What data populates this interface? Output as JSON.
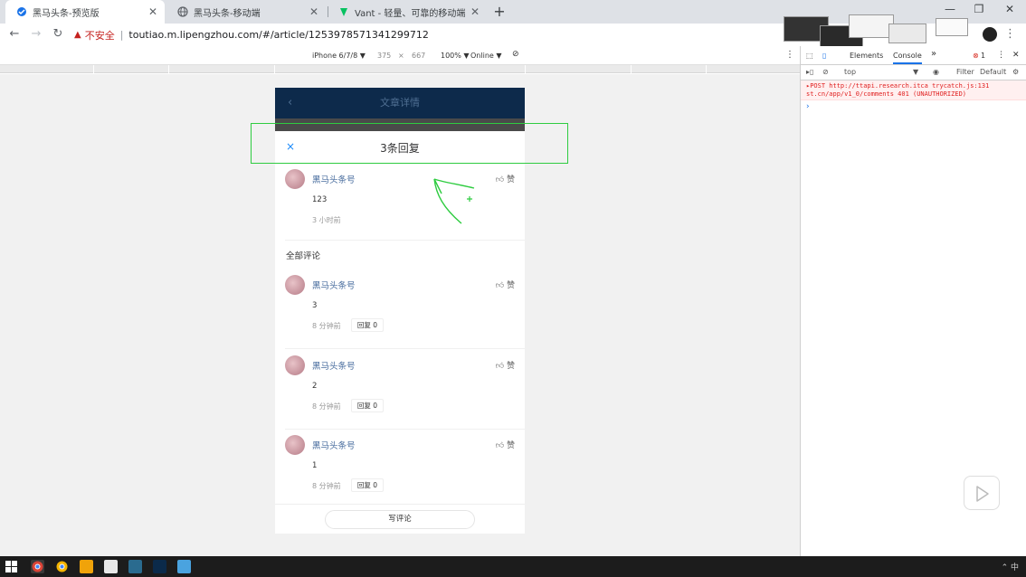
{
  "browser": {
    "tabs": [
      {
        "label": "黑马头条-预览版",
        "active": true
      },
      {
        "label": "黑马头条-移动端",
        "active": false
      },
      {
        "label": "Vant - 轻量、可靠的移动端 Vue",
        "active": false
      }
    ],
    "new_tab": "+",
    "window_buttons": {
      "minimize": "—",
      "restore": "❐",
      "close": "✕"
    },
    "security_label": "不安全",
    "url": "toutiao.m.lipengzhou.com/#/article/1253978571341299712"
  },
  "device_toolbar": {
    "device": "iPhone 6/7/8 ▼",
    "width": "375",
    "times": "×",
    "height": "667",
    "zoom": "100% ▼",
    "network": "Online ▼"
  },
  "phone": {
    "nav_title": "文章详情",
    "popup_title": "3条回复",
    "close_icon": "×",
    "like_label": "赞",
    "all_comments_heading": "全部评论",
    "top_comment": {
      "user": "黑马头条号",
      "text": "123",
      "time": "3 小时前"
    },
    "comments": [
      {
        "user": "黑马头条号",
        "text": "3",
        "time": "8 分钟前",
        "reply": "回复 0"
      },
      {
        "user": "黑马头条号",
        "text": "2",
        "time": "8 分钟前",
        "reply": "回复 0"
      },
      {
        "user": "黑马头条号",
        "text": "1",
        "time": "8 分钟前",
        "reply": "回复 0"
      }
    ],
    "write_comment": "写评论"
  },
  "devtools": {
    "tabs": {
      "elements": "Elements",
      "console": "Console",
      "more": "»"
    },
    "error_count": "1",
    "context": "top",
    "filter": "Filter",
    "levels": "Default",
    "error_line1": "▸POST http://ttapi.research.itca  trycatch.js:131",
    "error_line2": "st.cn/app/v1_0/comments 401 (UNAUTHORIZED)",
    "prompt": "›"
  },
  "taskbar": {
    "clock": "中"
  },
  "colors": {
    "nav_bg": "#0d2a4b",
    "username": "#466b9d",
    "annotation": "#2ecc40",
    "error": "#e02020"
  }
}
